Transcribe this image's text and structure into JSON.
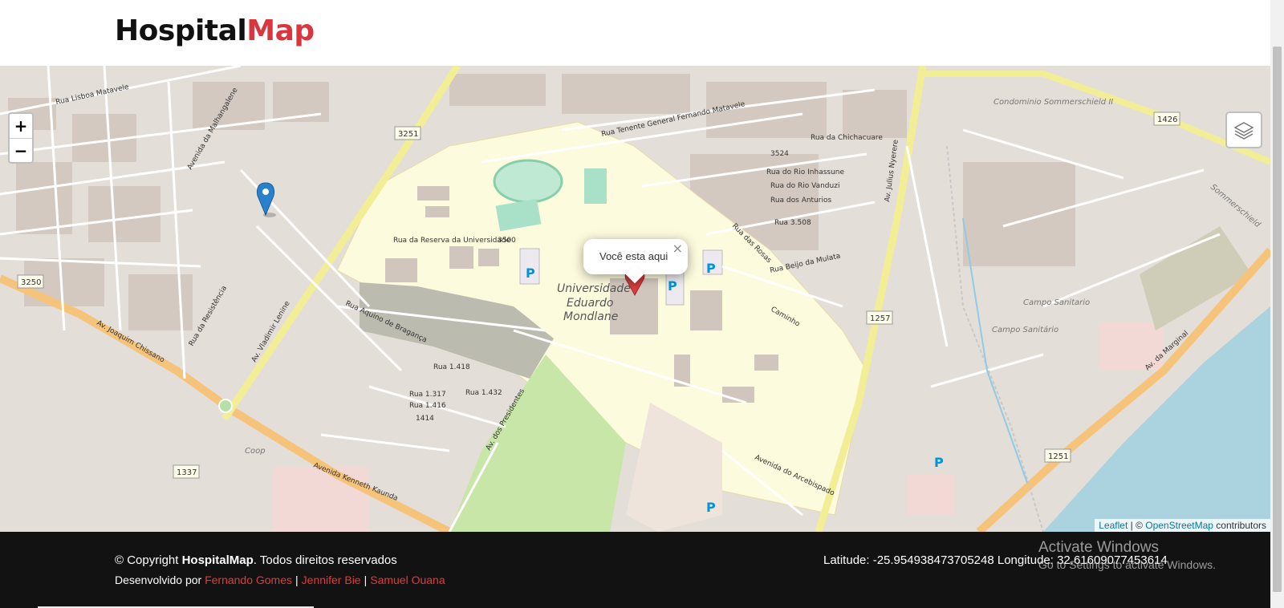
{
  "header": {
    "brand_part1": "Hospital",
    "brand_part2": "Map",
    "accent_color": "#d9363e"
  },
  "map": {
    "zoom_in": "+",
    "zoom_out": "−",
    "layers_icon": "layers-icon",
    "popup_text": "Você esta aqui",
    "popup_close": "×",
    "attribution": {
      "leaflet": "Leaflet",
      "separator": " | © ",
      "osm": "OpenStreetMap",
      "suffix": " contributors"
    },
    "labels": {
      "university_l1": "Universidade",
      "university_l2": "Eduardo",
      "university_l3": "Mondlane",
      "rua_reserva": "Rua da Reserva da Universidade",
      "av_lenine": "Av. Vladimir Lenine",
      "av_nyerere": "Av. Julius Nyerere",
      "av_chissano": "Av. Joaquim Chissano",
      "av_kaunda": "Avenida Kenneth Kaunda",
      "av_marginal": "Av. da Marginal",
      "av_presidentes": "Av. dos Presidentes",
      "rua_mulata": "Rua Beijo da Mulata",
      "rua_chichacuare": "Rua da Chichacuare",
      "rua_malhangalene": "Avenida da Malhangalene",
      "rua_resistencia": "Rua da Resistência",
      "rua_aquino": "Rua Aquino de Bragança",
      "rua_lisboa": "Rua Lisboa Matavele",
      "rua_matavele": "Rua Tenente General Fernando Matavele",
      "rua_arcebispado": "Avenida do Arcebispado",
      "condominio": "Condominio Sommerschield II",
      "campo1": "Campo Sanitario",
      "campo2": "Campo Sanitário",
      "coop": "Coop",
      "sommerschield": "Sommerschield",
      "r3251": "3251",
      "r3250": "3250",
      "r1426": "1426",
      "r1257": "1257",
      "r1337": "1337",
      "r1251": "1251",
      "rua_1418": "Rua 1.418",
      "rua_1317": "Rua 1.317",
      "rua_1432": "Rua 1.432",
      "rua_1416": "Rua 1.416",
      "rua_1414": "1414",
      "rua_3500": "3500",
      "rua_3524": "3524",
      "rua_inhassune": "Rua do Rio Inhassune",
      "rua_vanduzi": "Rua do Rio Vanduzi",
      "rua_anturios": "Rua dos Anturios",
      "rua_3508": "Rua 3.508",
      "rua_rosas": "Rua das Rosas",
      "rua_camino": "Caminho"
    }
  },
  "footer": {
    "copyright_prefix": "© Copyright ",
    "copyright_brand": "HospitalMap",
    "copyright_suffix": ". Todos direitos reservados",
    "developed_by": "Desenvolvido por ",
    "dev1": "Fernando Gomes",
    "dev2": "Jennifer Bie",
    "dev3": "Samuel Ouana",
    "divider": "|",
    "coordinates": "Latitude: -25.954938473705248 Longitude: 32.61609077453614"
  },
  "watermark": {
    "line1": "Activate Windows",
    "line2": "Go to Settings to activate Windows."
  }
}
